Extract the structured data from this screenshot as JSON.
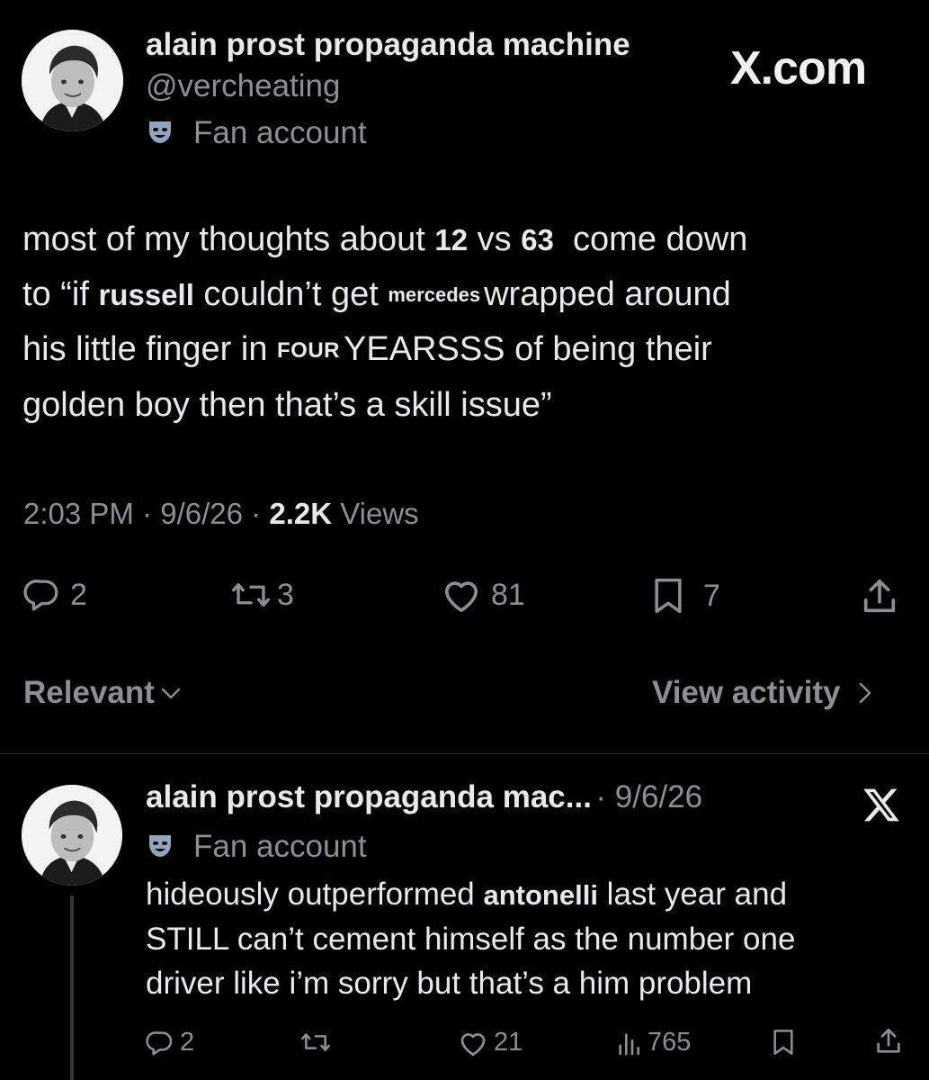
{
  "brand": {
    "watermark": "X.com"
  },
  "main_tweet": {
    "author_name": "alain prost propaganda machine",
    "handle": "@vercheating",
    "label": "Fan account",
    "text": {
      "l1_a": "most of my thoughts about ",
      "l1_b": "12",
      "l1_c": " vs ",
      "l1_d": "63",
      "l1_e": "  come down",
      "l2_a": "to “if ",
      "l2_b": "russell",
      "l2_c": " couldn’t get ",
      "l2_d": "mercedes",
      "l2_e": "wrapped around",
      "l3_a": "his little finger in ",
      "l3_b": "FOUR",
      "l3_c": "YEARSSS of being their",
      "l4": "golden boy then that’s a skill issue”"
    },
    "time": "2:03 PM",
    "date": "9/6/26",
    "views_count": "2.2K",
    "views_label": "Views",
    "sep": "·",
    "replies": "2",
    "reposts": "3",
    "likes": "81",
    "bookmarks": "7"
  },
  "sort": {
    "relevant_label": "Relevant",
    "view_activity_label": "View activity"
  },
  "reply_tweet": {
    "author_name": "alain prost propaganda mac...",
    "date": "· 9/6/26",
    "label": "Fan account",
    "text": {
      "l1_a": "hideously outperformed ",
      "l1_b": "antonelli",
      "l1_c": " last year and",
      "l2": "STILL can’t cement himself as the number one",
      "l3": "driver like i’m sorry but that’s a him problem"
    },
    "replies": "2",
    "likes": "21",
    "views": "765"
  },
  "icons": [
    "theater-mask-icon",
    "reply-icon",
    "repost-icon",
    "like-icon",
    "bookmark-icon",
    "share-icon",
    "chevron-down-icon",
    "chevron-right-icon",
    "views-icon",
    "x-logo-icon"
  ]
}
